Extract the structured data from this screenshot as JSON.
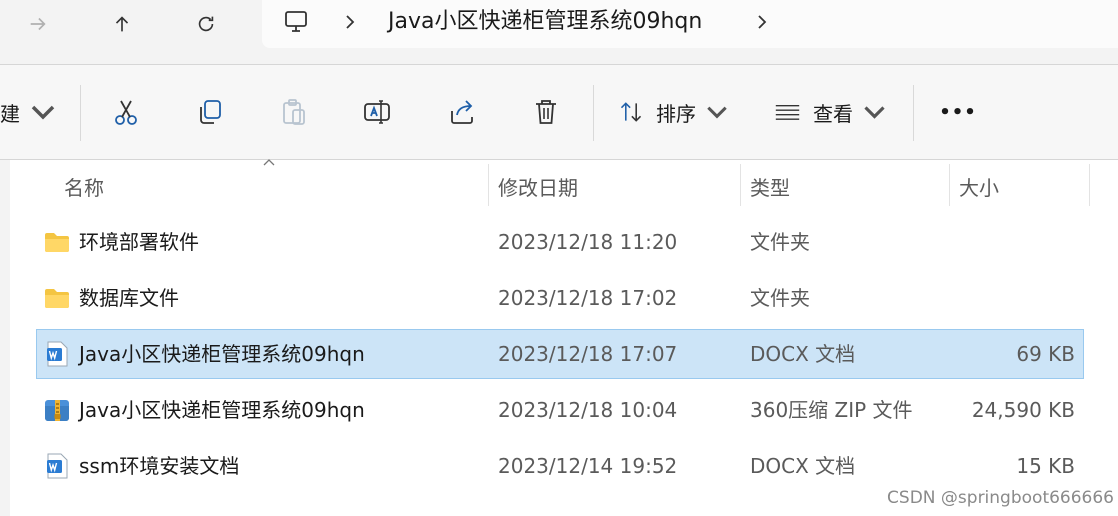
{
  "address": {
    "path": "Java小区快递柜管理系统09hqn"
  },
  "toolbar": {
    "new_label": "新建",
    "sort_label": "排序",
    "view_label": "查看",
    "more_label": "•••"
  },
  "columns": {
    "name": "名称",
    "date": "修改日期",
    "type": "类型",
    "size": "大小"
  },
  "files": [
    {
      "name": "环境部署软件",
      "date": "2023/12/18 11:20",
      "type": "文件夹",
      "size": "",
      "icon": "folder-icon"
    },
    {
      "name": "数据库文件",
      "date": "2023/12/18 17:02",
      "type": "文件夹",
      "size": "",
      "icon": "folder-icon"
    },
    {
      "name": "Java小区快递柜管理系统09hqn",
      "date": "2023/12/18 17:07",
      "type": "DOCX 文档",
      "size": "69 KB",
      "icon": "docx-icon",
      "selected": true
    },
    {
      "name": "Java小区快递柜管理系统09hqn",
      "date": "2023/12/18 10:04",
      "type": "360压缩 ZIP 文件",
      "size": "24,590 KB",
      "icon": "zip-icon"
    },
    {
      "name": "ssm环境安装文档",
      "date": "2023/12/14 19:52",
      "type": "DOCX 文档",
      "size": "15 KB",
      "icon": "docx-icon"
    }
  ],
  "watermark": "CSDN @springboot666666",
  "colors": {
    "selection": "#cce4f7",
    "folder": "#f4c542",
    "docx": "#2b7cd3"
  }
}
